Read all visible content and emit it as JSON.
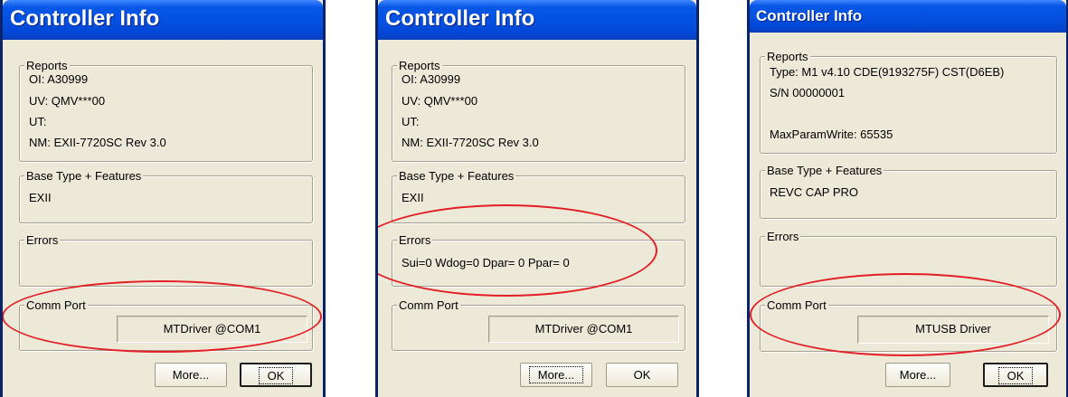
{
  "windows": [
    {
      "title": "Controller Info",
      "reports": {
        "legend": "Reports",
        "lines": [
          "OI:  A30999",
          "UV: QMV***00",
          "UT:",
          "NM: EXII-7720SC Rev 3.0"
        ]
      },
      "base_type": {
        "legend": "Base Type + Features",
        "value": "EXII"
      },
      "errors": {
        "legend": "Errors",
        "value": ""
      },
      "comm_port": {
        "legend": "Comm Port",
        "value": "MTDriver @COM1"
      },
      "buttons": {
        "more": "More...",
        "ok": "OK"
      }
    },
    {
      "title": "Controller Info",
      "reports": {
        "legend": "Reports",
        "lines": [
          "OI:  A30999",
          "UV: QMV***00",
          "UT:",
          "NM: EXII-7720SC Rev 3.0"
        ]
      },
      "base_type": {
        "legend": "Base Type + Features",
        "value": "EXII"
      },
      "errors": {
        "legend": "Errors",
        "value": "Sui=0 Wdog=0 Dpar= 0 Ppar= 0"
      },
      "comm_port": {
        "legend": "Comm Port",
        "value": "MTDriver @COM1"
      },
      "buttons": {
        "more": "More...",
        "ok": "OK"
      }
    },
    {
      "title": "Controller Info",
      "reports": {
        "legend": "Reports",
        "lines": [
          "Type: M1 v4.10 CDE(9193275F) CST(D6EB)",
          "S/N 00000001",
          "",
          "MaxParamWrite: 65535"
        ]
      },
      "base_type": {
        "legend": "Base Type + Features",
        "value": "REVC CAP PRO"
      },
      "errors": {
        "legend": "Errors",
        "value": ""
      },
      "comm_port": {
        "legend": "Comm Port",
        "value": "MTUSB Driver"
      },
      "buttons": {
        "more": "More...",
        "ok": "OK"
      }
    }
  ],
  "highlight_color": "#e31e24"
}
